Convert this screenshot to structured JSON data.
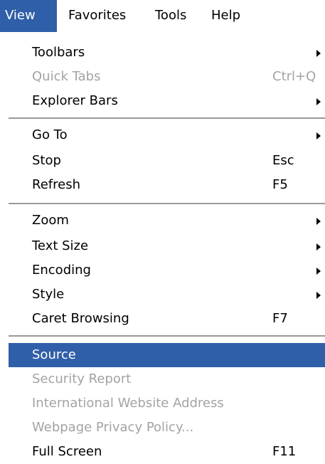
{
  "menubar": {
    "items": [
      {
        "label": "View"
      },
      {
        "label": "Favorites"
      },
      {
        "label": "Tools"
      },
      {
        "label": "Help"
      }
    ]
  },
  "view_menu": {
    "toolbars": {
      "label": "Toolbars"
    },
    "quick_tabs": {
      "label": "Quick Tabs",
      "shortcut": "Ctrl+Q"
    },
    "explorer_bars": {
      "label": "Explorer Bars"
    },
    "go_to": {
      "label": "Go To"
    },
    "stop": {
      "label": "Stop",
      "shortcut": "Esc"
    },
    "refresh": {
      "label": "Refresh",
      "shortcut": "F5"
    },
    "zoom": {
      "label": "Zoom"
    },
    "text_size": {
      "label": "Text Size"
    },
    "encoding": {
      "label": "Encoding"
    },
    "style": {
      "label": "Style"
    },
    "caret_browsing": {
      "label": "Caret Browsing",
      "shortcut": "F7"
    },
    "source": {
      "label": "Source"
    },
    "security_report": {
      "label": "Security Report"
    },
    "international_address": {
      "label": "International Website Address"
    },
    "privacy_policy": {
      "label": "Webpage Privacy Policy..."
    },
    "full_screen": {
      "label": "Full Screen",
      "shortcut": "F11"
    }
  },
  "colors": {
    "highlight": "#2f5fa8",
    "disabled_text": "#a3a3a3",
    "separator": "#9a9a9a"
  }
}
